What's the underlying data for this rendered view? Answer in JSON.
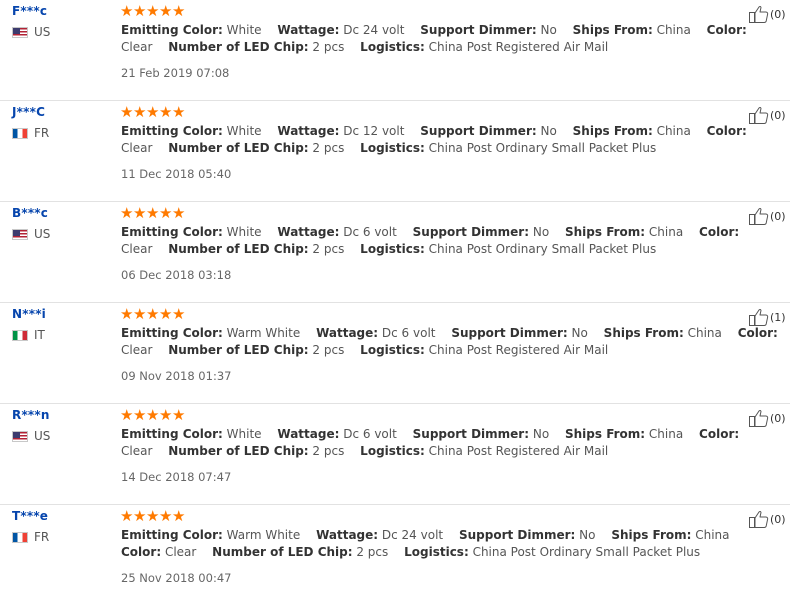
{
  "reviews": [
    {
      "user": "F***c",
      "country": "US",
      "flag": "us",
      "stars": 5,
      "helpful": "(0)",
      "attrs": [
        {
          "name": "Emitting Color:",
          "value": "White"
        },
        {
          "name": "Wattage:",
          "value": "Dc 24 volt"
        },
        {
          "name": "Support Dimmer:",
          "value": "No"
        },
        {
          "name": "Ships From:",
          "value": "China"
        },
        {
          "name": "Color:",
          "value": "Clear"
        },
        {
          "name": "Number of LED Chip:",
          "value": "2 pcs"
        },
        {
          "name": "Logistics:",
          "value": "China Post Registered Air Mail"
        }
      ],
      "date": "21 Feb 2019 07:08"
    },
    {
      "user": "J***C",
      "country": "FR",
      "flag": "fr",
      "stars": 5,
      "helpful": "(0)",
      "attrs": [
        {
          "name": "Emitting Color:",
          "value": "White"
        },
        {
          "name": "Wattage:",
          "value": "Dc 12 volt"
        },
        {
          "name": "Support Dimmer:",
          "value": "No"
        },
        {
          "name": "Ships From:",
          "value": "China"
        },
        {
          "name": "Color:",
          "value": "Clear"
        },
        {
          "name": "Number of LED Chip:",
          "value": "2 pcs"
        },
        {
          "name": "Logistics:",
          "value": "China Post Ordinary Small Packet Plus"
        }
      ],
      "date": "11 Dec 2018 05:40"
    },
    {
      "user": "B***c",
      "country": "US",
      "flag": "us",
      "stars": 5,
      "helpful": "(0)",
      "attrs": [
        {
          "name": "Emitting Color:",
          "value": "White"
        },
        {
          "name": "Wattage:",
          "value": "Dc 6 volt"
        },
        {
          "name": "Support Dimmer:",
          "value": "No"
        },
        {
          "name": "Ships From:",
          "value": "China"
        },
        {
          "name": "Color:",
          "value": "Clear"
        },
        {
          "name": "Number of LED Chip:",
          "value": "2 pcs"
        },
        {
          "name": "Logistics:",
          "value": "China Post Ordinary Small Packet Plus"
        }
      ],
      "date": "06 Dec 2018 03:18"
    },
    {
      "user": "N***i",
      "country": "IT",
      "flag": "it",
      "stars": 5,
      "helpful": "(1)",
      "attrs": [
        {
          "name": "Emitting Color:",
          "value": "Warm White"
        },
        {
          "name": "Wattage:",
          "value": "Dc 6 volt"
        },
        {
          "name": "Support Dimmer:",
          "value": "No"
        },
        {
          "name": "Ships From:",
          "value": "China"
        },
        {
          "name": "Color:",
          "value": "Clear"
        },
        {
          "name": "Number of LED Chip:",
          "value": "2 pcs"
        },
        {
          "name": "Logistics:",
          "value": "China Post Registered Air Mail"
        }
      ],
      "date": "09 Nov 2018 01:37"
    },
    {
      "user": "R***n",
      "country": "US",
      "flag": "us",
      "stars": 5,
      "helpful": "(0)",
      "attrs": [
        {
          "name": "Emitting Color:",
          "value": "White"
        },
        {
          "name": "Wattage:",
          "value": "Dc 6 volt"
        },
        {
          "name": "Support Dimmer:",
          "value": "No"
        },
        {
          "name": "Ships From:",
          "value": "China"
        },
        {
          "name": "Color:",
          "value": "Clear"
        },
        {
          "name": "Number of LED Chip:",
          "value": "2 pcs"
        },
        {
          "name": "Logistics:",
          "value": "China Post Registered Air Mail"
        }
      ],
      "date": "14 Dec 2018 07:47"
    },
    {
      "user": "T***e",
      "country": "FR",
      "flag": "fr",
      "stars": 5,
      "helpful": "(0)",
      "attrs": [
        {
          "name": "Emitting Color:",
          "value": "Warm White"
        },
        {
          "name": "Wattage:",
          "value": "Dc 24 volt"
        },
        {
          "name": "Support Dimmer:",
          "value": "No"
        },
        {
          "name": "Ships From:",
          "value": "China"
        },
        {
          "name": "Color:",
          "value": "Clear"
        },
        {
          "name": "Number of LED Chip:",
          "value": "2 pcs"
        },
        {
          "name": "Logistics:",
          "value": "China Post Ordinary Small Packet Plus"
        }
      ],
      "date": "25 Nov 2018 00:47"
    }
  ],
  "colors": {
    "star": "#ff7a00",
    "username": "#0645ad",
    "divider": "#e2e2e2"
  },
  "icons": {
    "star": "star-icon",
    "helpful": "thumbs-up-icon"
  }
}
